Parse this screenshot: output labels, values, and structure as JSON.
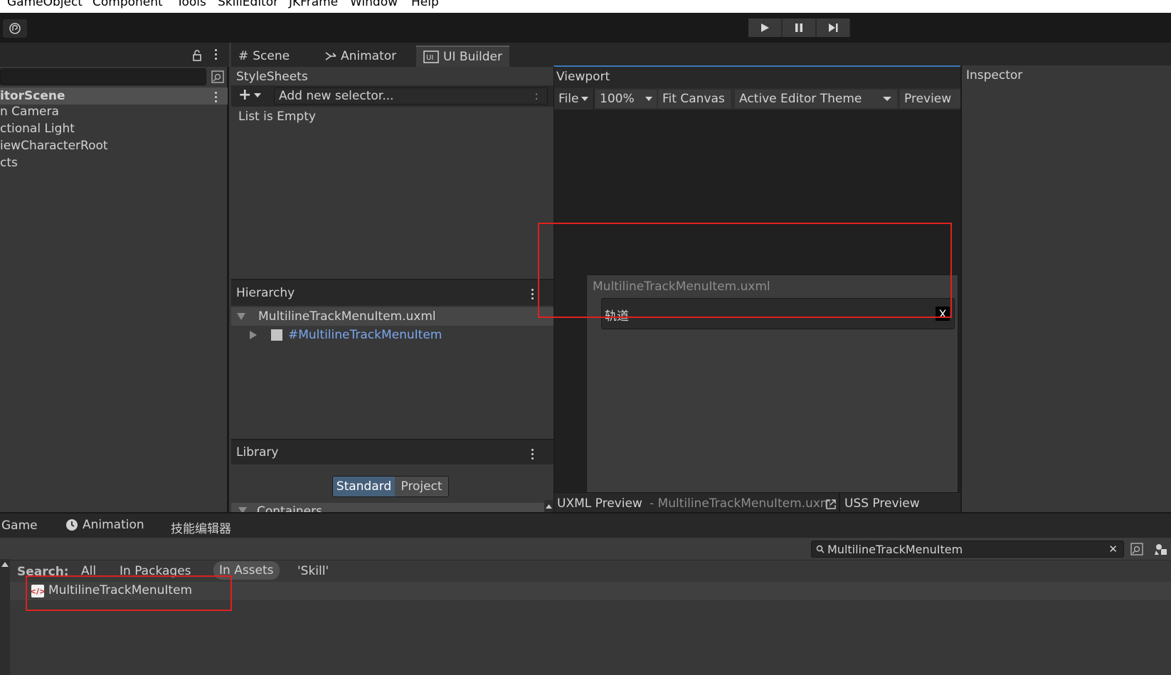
{
  "menu": [
    "GameObject",
    "Component",
    "Tools",
    "SkillEditor",
    "JKFrame",
    "Window",
    "Help"
  ],
  "left_panel": {
    "scene": "itorScene",
    "items": [
      "n Camera",
      "ctional Light",
      "iewCharacterRoot",
      "cts"
    ]
  },
  "tabs": [
    {
      "label": "Scene",
      "icon": "hash-icon"
    },
    {
      "label": "Animator",
      "icon": "animator-icon"
    },
    {
      "label": "UI Builder",
      "icon": "ui-icon"
    }
  ],
  "stylesheets": {
    "title": "StyleSheets",
    "add_selector_placeholder": "Add new selector...",
    "colon": ":",
    "empty_text": "List is Empty"
  },
  "hierarchy": {
    "title": "Hierarchy",
    "root": "MultilineTrackMenuItem.uxml",
    "child": "#MultilineTrackMenuItem"
  },
  "library": {
    "title": "Library",
    "standard": "Standard",
    "project": "Project",
    "containers": "Containers"
  },
  "viewport": {
    "title": "Viewport",
    "file": "File",
    "zoom": "100%",
    "fit": "Fit Canvas",
    "theme": "Active Editor Theme",
    "preview": "Preview",
    "canvas_title": "MultilineTrackMenuItem.uxml",
    "item_label": "轨道",
    "close_label": "X",
    "uxml_preview": "UXML Preview",
    "uxml_file": "- MultilineTrackMenuItem.uxml",
    "uss_preview": "USS Preview"
  },
  "inspector": {
    "title": "Inspector"
  },
  "bottom": {
    "tabs": [
      "Game",
      "Animation",
      "技能编辑器"
    ],
    "search_value": "MultilineTrackMenuItem",
    "search_label": "Search:",
    "filters": [
      "All",
      "In Packages",
      "In Assets",
      "'Skill'"
    ],
    "result": "MultilineTrackMenuItem"
  },
  "colors": {
    "accent": "#3a79bb",
    "highlight": "#e02020",
    "link": "#7aa7ef"
  }
}
